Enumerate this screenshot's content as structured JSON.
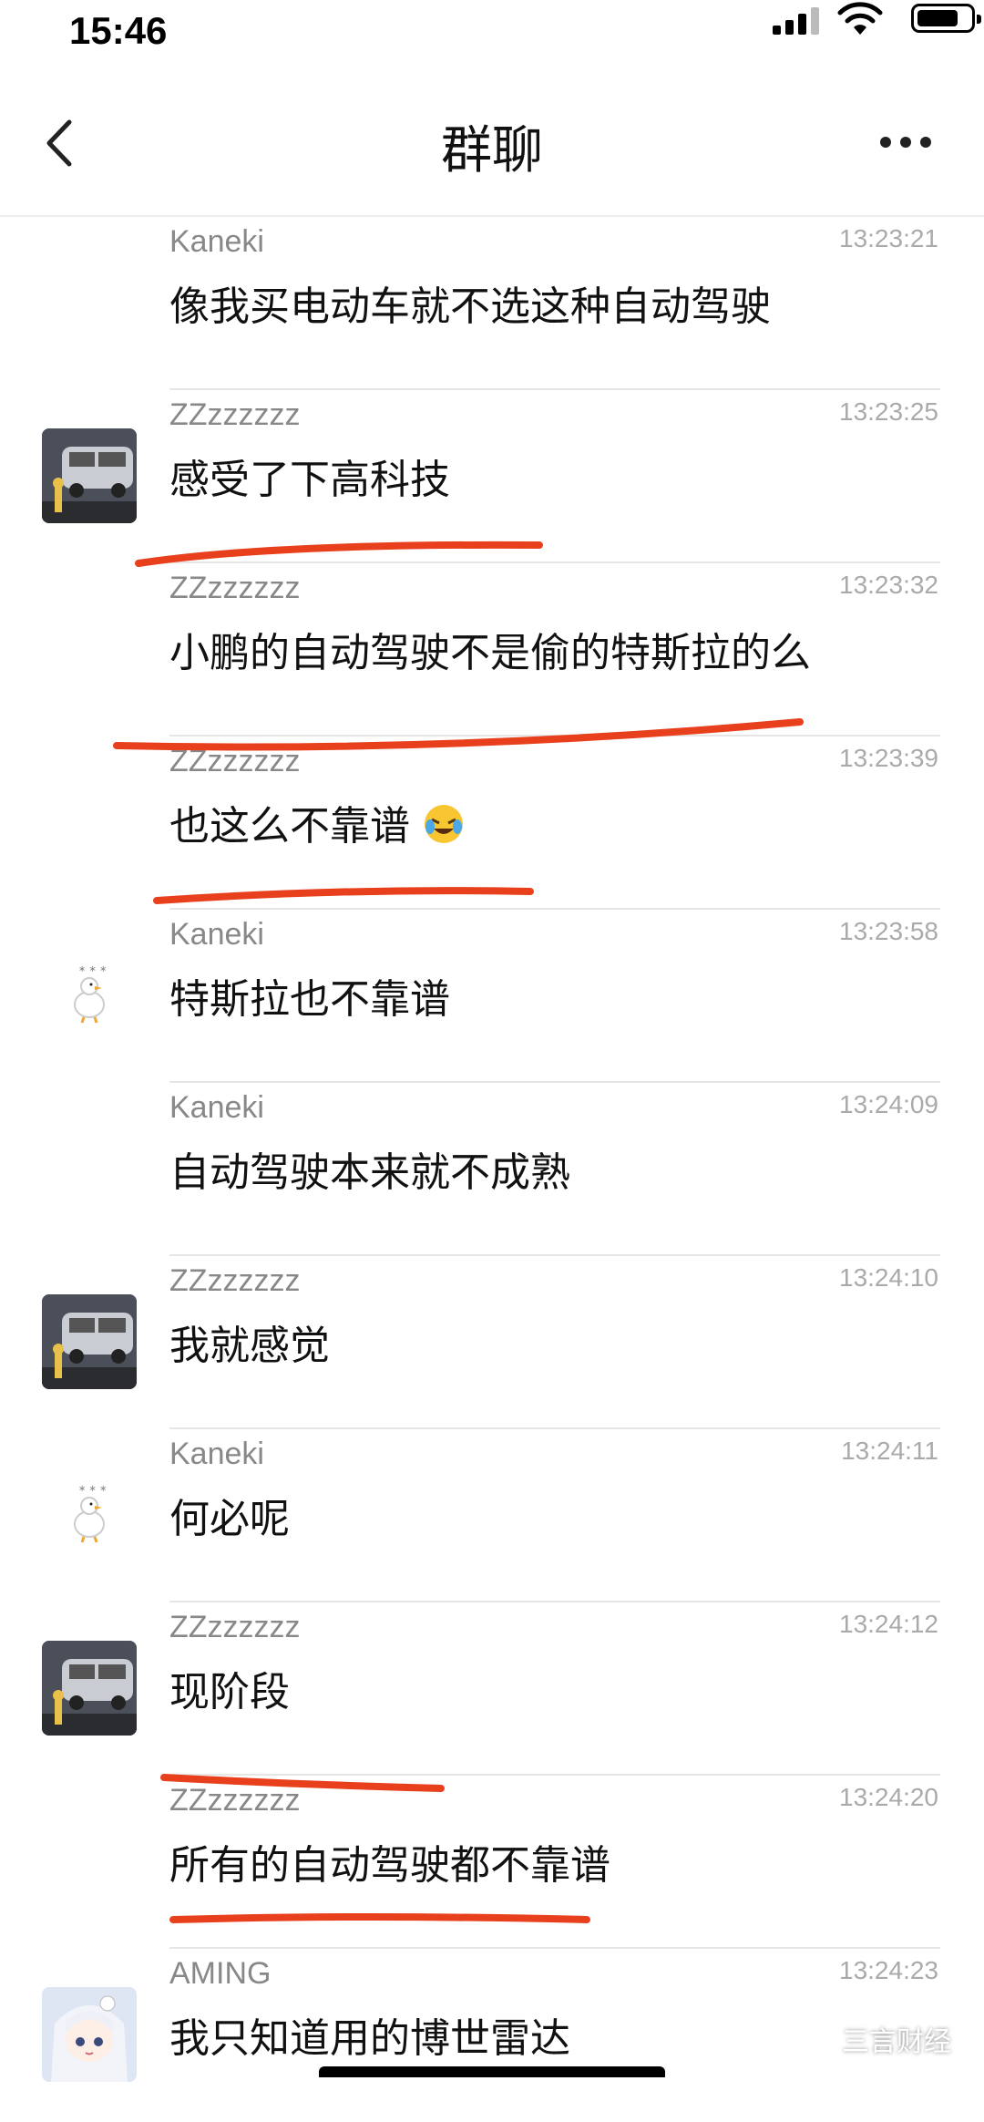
{
  "status_bar": {
    "time": "15:46"
  },
  "nav": {
    "title": "群聊"
  },
  "messages": [
    {
      "sender": "Kaneki",
      "time": "13:23:21",
      "text": "像我买电动车就不选这种自动驾驶",
      "avatar": "none"
    },
    {
      "sender": "ZZzzzzzz",
      "time": "13:23:25",
      "text": "感受了下高科技",
      "avatar": "van"
    },
    {
      "sender": "ZZzzzzzz",
      "time": "13:23:32",
      "text": "小鹏的自动驾驶不是偷的特斯拉的么",
      "avatar": "none"
    },
    {
      "sender": "ZZzzzzzz",
      "time": "13:23:39",
      "text": "也这么不靠谱",
      "avatar": "none",
      "emoji": "laughing-crying-emoji"
    },
    {
      "sender": "Kaneki",
      "time": "13:23:58",
      "text": "特斯拉也不靠谱",
      "avatar": "goose"
    },
    {
      "sender": "Kaneki",
      "time": "13:24:09",
      "text": "自动驾驶本来就不成熟",
      "avatar": "none"
    },
    {
      "sender": "ZZzzzzzz",
      "time": "13:24:10",
      "text": "我就感觉",
      "avatar": "van"
    },
    {
      "sender": "Kaneki",
      "time": "13:24:11",
      "text": "何必呢",
      "avatar": "goose"
    },
    {
      "sender": "ZZzzzzzz",
      "time": "13:24:12",
      "text": "现阶段",
      "avatar": "van"
    },
    {
      "sender": "ZZzzzzzz",
      "time": "13:24:20",
      "text": "所有的自动驾驶都不靠谱",
      "avatar": "none"
    },
    {
      "sender": "AMING",
      "time": "13:24:23",
      "text": "我只知道用的博世雷达",
      "avatar": "anime"
    }
  ],
  "annotation_color": "#e8401c",
  "watermark": "三言财经"
}
